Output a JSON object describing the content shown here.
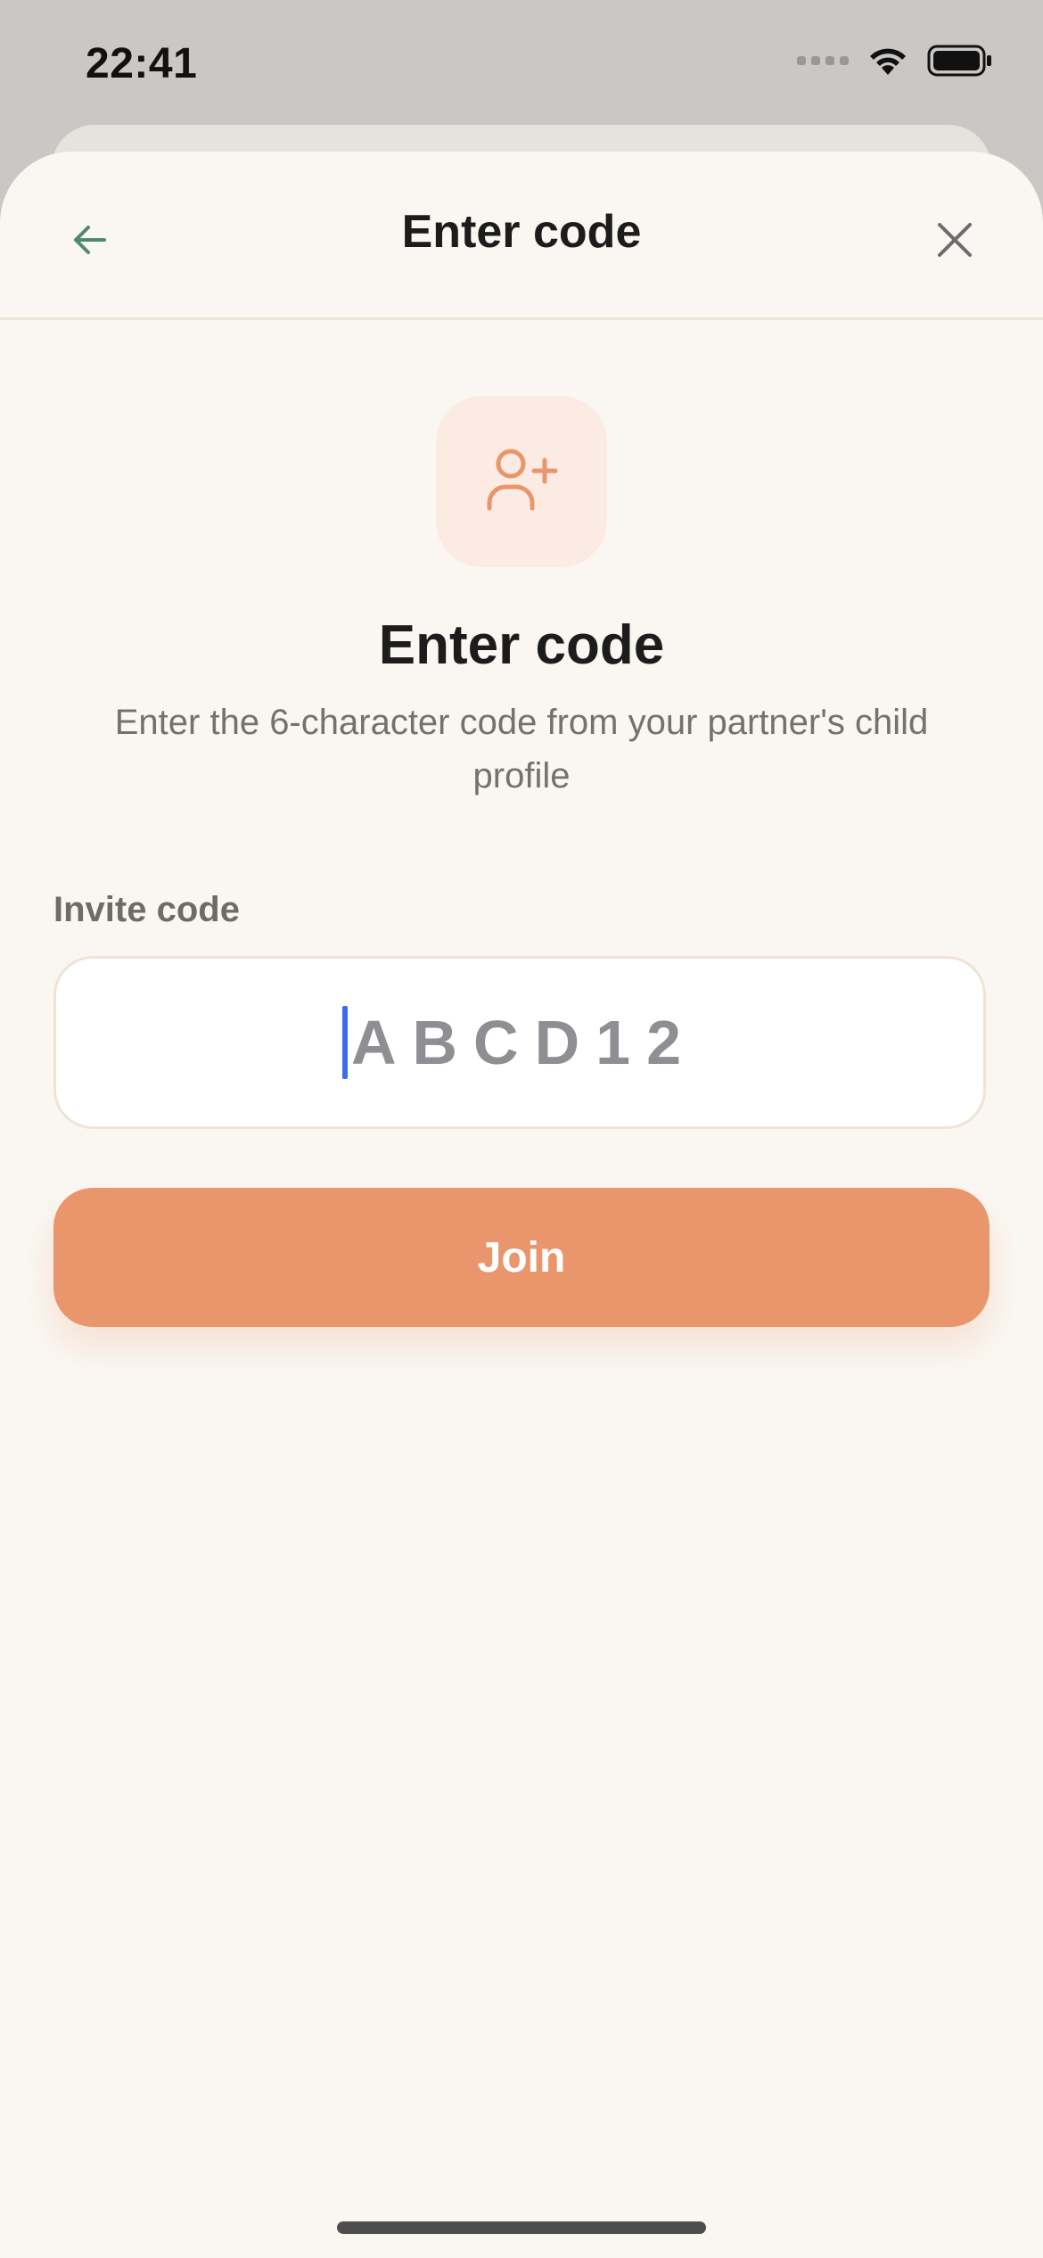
{
  "status_bar": {
    "time": "22:41",
    "icons": [
      "cellular-signal-icon",
      "wifi-icon",
      "battery-icon"
    ]
  },
  "nav": {
    "title": "Enter code",
    "back_icon": "arrow-left-icon",
    "close_icon": "close-icon"
  },
  "hero": {
    "icon": "user-plus-icon",
    "heading": "Enter code",
    "subtitle": "Enter the 6-character code from your partner's child profile"
  },
  "form": {
    "label": "Invite code",
    "input_value": "",
    "input_placeholder": "ABCD12"
  },
  "actions": {
    "join_label": "Join"
  },
  "colors": {
    "accent": "#e9966d",
    "accent_light": "#fbebe3",
    "nav_icon_green": "#4f8a6f",
    "background": "#faf7f2",
    "caret": "#3b6cf0"
  }
}
